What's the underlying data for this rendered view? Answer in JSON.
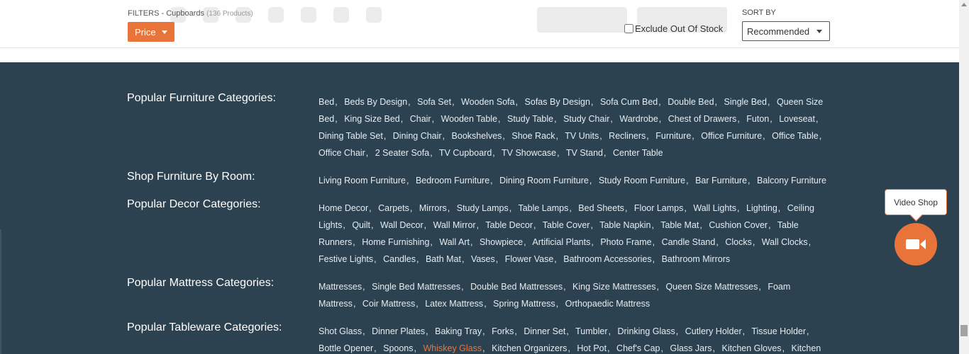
{
  "filters": {
    "label": "FILTERS - Cupboards",
    "count": "(136 Products)",
    "price_button": "Price",
    "exclude_out_of_stock": "Exclude Out Of Stock",
    "sort_label": "SORT BY",
    "sort_value": "Recommended"
  },
  "categories": [
    {
      "title": "Popular Furniture Categories:",
      "links": [
        "Bed",
        "Beds By Design",
        "Sofa Set",
        "Wooden Sofa",
        "Sofas By Design",
        "Sofa Cum Bed",
        "Double Bed",
        "Single Bed",
        "Queen Size Bed",
        "King Size Bed",
        "Chair",
        "Wooden Table",
        "Study Table",
        "Study Chair",
        "Wardrobe",
        "Chest of Drawers",
        "Futon",
        "Loveseat",
        "Dining Table Set",
        "Dining Chair",
        "Bookshelves",
        "Shoe Rack",
        "TV Units",
        "Recliners",
        "Furniture",
        "Office Furniture",
        "Office Table",
        "Office Chair",
        "2 Seater Sofa",
        "TV Cupboard",
        "TV Showcase",
        "TV Stand",
        "Center Table"
      ]
    },
    {
      "title": "Shop Furniture By Room:",
      "links": [
        "Living Room Furniture",
        "Bedroom Furniture",
        "Dining Room Furniture",
        "Study Room Furniture",
        "Bar Furniture",
        "Balcony Furniture"
      ]
    },
    {
      "title": "Popular Decor Categories:",
      "links": [
        "Home Decor",
        "Carpets",
        "Mirrors",
        "Study Lamps",
        "Table Lamps",
        "Bed Sheets",
        "Floor Lamps",
        "Wall Lights",
        "Lighting",
        "Ceiling Lights",
        "Quilt",
        "Wall Decor",
        "Wall Mirror",
        "Table Decor",
        "Table Cover",
        "Table Napkin",
        "Table Mat",
        "Cushion Cover",
        "Table Runners",
        "Home Furnishing",
        "Wall Art",
        "Showpiece",
        "Artificial Plants",
        "Photo Frame",
        "Candle Stand",
        "Clocks",
        "Wall Clocks",
        "Festive Lights",
        "Candles",
        "Bath Mat",
        "Vases",
        "Flower Vase",
        "Bathroom Accessories",
        "Bathroom Mirrors"
      ]
    },
    {
      "title": "Popular Mattress Categories:",
      "links": [
        "Mattresses",
        "Single Bed Mattresses",
        "Double Bed Mattresses",
        "King Size Mattresses",
        "Queen Size Mattresses",
        "Foam Mattress",
        "Coir Mattress",
        "Latex Mattress",
        "Spring Mattress",
        "Orthopaedic Mattress"
      ]
    },
    {
      "title": "Popular Tableware Categories:",
      "links": [
        "Shot Glass",
        "Dinner Plates",
        "Baking Tray",
        "Forks",
        "Dinner Set",
        "Tumbler",
        "Drinking Glass",
        "Cutlery Holder",
        "Tissue Holder",
        "Bottle Opener",
        "Spoons",
        "Whiskey Glass",
        "Kitchen Organizers",
        "Hot Pot",
        "Chef's Cap",
        "Glass Jars",
        "Kitchen Gloves",
        "Kitchen"
      ],
      "highlighted": "Whiskey Glass"
    }
  ],
  "video_shop": {
    "label": "Video Shop",
    "icon": "video-camera-icon"
  },
  "colors": {
    "accent": "#e9743a",
    "footer_bg": "#2d4250",
    "link": "#e6ecf0"
  }
}
